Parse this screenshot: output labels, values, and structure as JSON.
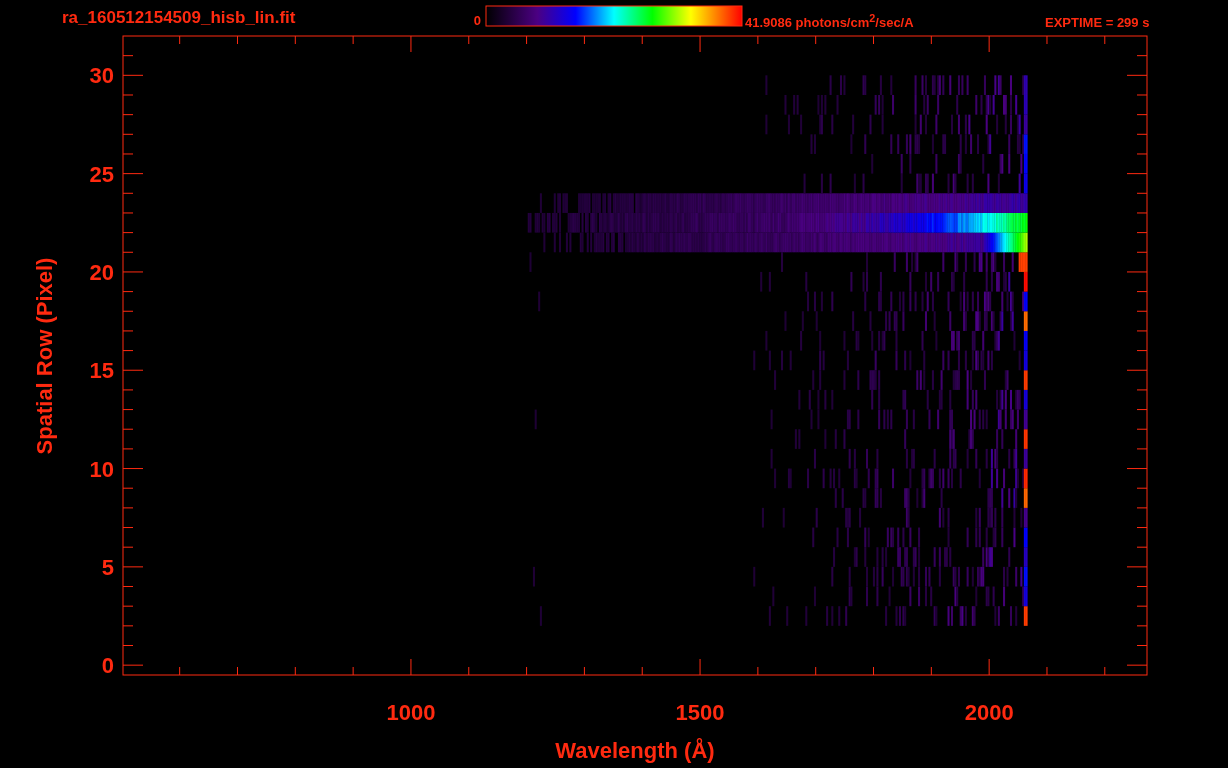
{
  "header": {
    "file_name": "ra_160512154509_hisb_lin.fit",
    "scale_min": "0",
    "scale_max": "41.9086 photons/cm$^{2}$/sec/A",
    "exposure": "EXPTIME = 299 s"
  },
  "plot": {
    "y_axis": {
      "title": "Spatial Row (Pixel)",
      "ticks": [
        "30",
        "25",
        "20",
        "15",
        "10",
        "5",
        "0"
      ]
    },
    "x_axis": {
      "title": "Wavelength (Å)",
      "ticks": [
        "1000",
        "1500",
        "2000"
      ]
    }
  }
}
